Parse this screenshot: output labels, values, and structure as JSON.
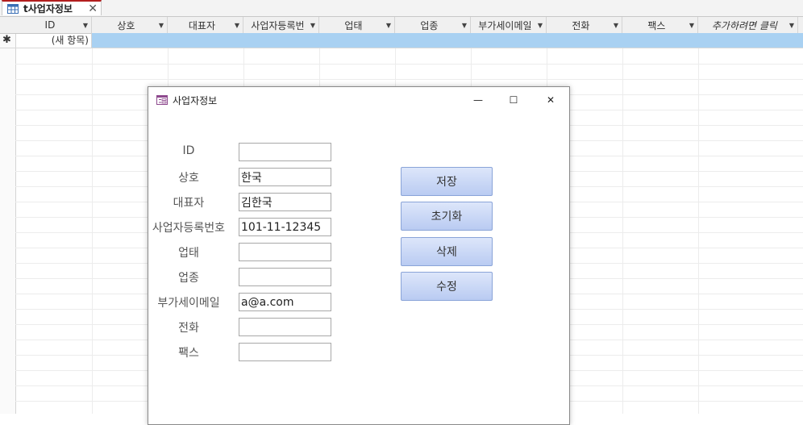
{
  "tab": {
    "label": "t사업자정보",
    "icon": "table-icon"
  },
  "columns": [
    {
      "label": "ID",
      "italic": false
    },
    {
      "label": "상호",
      "italic": false
    },
    {
      "label": "대표자",
      "italic": false
    },
    {
      "label": "사업자등록번",
      "italic": false
    },
    {
      "label": "업태",
      "italic": false
    },
    {
      "label": "업종",
      "italic": false
    },
    {
      "label": "부가세이메일",
      "italic": false
    },
    {
      "label": "전화",
      "italic": false
    },
    {
      "label": "팩스",
      "italic": false
    },
    {
      "label": "추가하려면 클릭",
      "italic": true
    }
  ],
  "new_row": {
    "marker": "✱",
    "label": "(새 항목)"
  },
  "dialog": {
    "title": "사업자정보",
    "controls": {
      "minimize": "—",
      "maximize": "☐",
      "close": "✕"
    },
    "fields": [
      {
        "label": "ID",
        "value": ""
      },
      {
        "label": "상호",
        "value": "한국"
      },
      {
        "label": "대표자",
        "value": "김한국"
      },
      {
        "label": "사업자등록번호",
        "value": "101-11-12345"
      },
      {
        "label": "업태",
        "value": ""
      },
      {
        "label": "업종",
        "value": ""
      },
      {
        "label": "부가세이메일",
        "value": "a@a.com"
      },
      {
        "label": "전화",
        "value": ""
      },
      {
        "label": "팩스",
        "value": ""
      }
    ],
    "buttons": {
      "save": "저장",
      "reset": "초기화",
      "delete": "삭제",
      "edit": "수정"
    }
  },
  "colors": {
    "row_highlight": "#a9d1f2",
    "button_bg": "#c7d6f5",
    "tab_accent": "#b31e1e"
  }
}
